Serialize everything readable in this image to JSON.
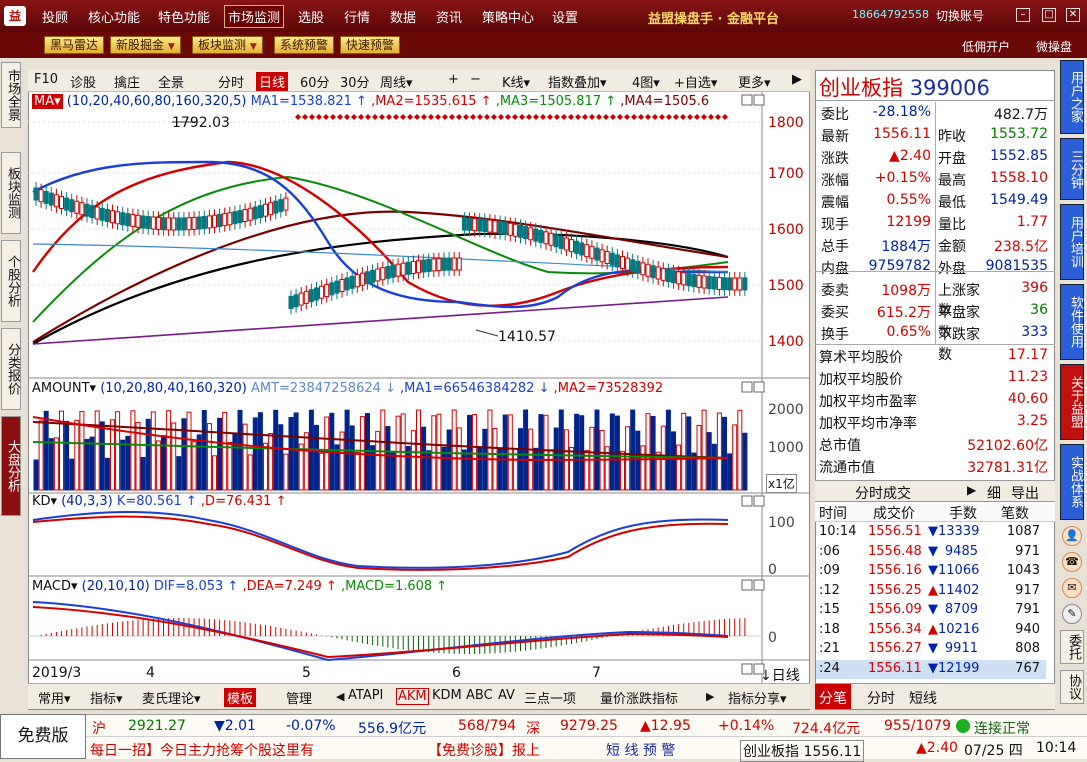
{
  "topbar": {
    "menus": [
      "投顾",
      "核心功能",
      "特色功能",
      "市场监测",
      "选股",
      "行情",
      "数据",
      "资讯",
      "策略中心",
      "设置"
    ],
    "selected": "市场监测",
    "brand": "益盟操盘手 · 金融平台",
    "phone": "18664792558",
    "account": "切换账号"
  },
  "toolbar": {
    "buttons": [
      "黑马雷达",
      "新股掘金",
      "板块监测",
      "系统预警",
      "快速预警"
    ],
    "right": [
      "低佣开户",
      "微操盘"
    ]
  },
  "lefttabs": [
    "市场全景",
    "板块监测",
    "个股分析",
    "分类报价",
    "大盘分析"
  ],
  "chart_toolbar": {
    "items": [
      "F10",
      "诊股",
      "擒庄",
      "全景",
      "分时",
      "日线",
      "60分",
      "30分",
      "周线▾",
      "+",
      "−",
      "K线▾",
      "指数叠加▾",
      "4图▾",
      "+自选▾",
      "更多▾"
    ],
    "selected": "日线"
  },
  "main_legend": {
    "name": "MA▾",
    "params": "(10,20,40,60,80,160,320,5)",
    "ma1": "MA1=1538.821 ↑",
    "ma2": ",MA2=1535.615 ↑",
    "ma3": ",MA3=1505.817 ↑",
    "ma4": ",MA4=1505.6"
  },
  "price_axis": [
    "1800",
    "1700",
    "1600",
    "1500",
    "1400"
  ],
  "annotations": {
    "high": "1792.03",
    "low": "1410.57"
  },
  "amount_legend": {
    "name": "AMOUNT▾",
    "params": "(10,20,80,40,160,320)",
    "amt": "AMT=23847258624 ↓",
    "ma1": ",MA1=66546384282 ↓",
    "ma2": ",MA2=73528392"
  },
  "amount_axis": [
    "2000",
    "1000"
  ],
  "amount_unit": "x1亿",
  "kd_legend": {
    "name": "KD▾",
    "params": "(40,3,3)",
    "k": "K=80.561 ↑",
    "d": ",D=76.431 ↑"
  },
  "kd_axis": [
    "100",
    "0"
  ],
  "macd_legend": {
    "name": "MACD▾",
    "params": "(20,10,10)",
    "dif": "DIF=8.053 ↑",
    "dea": ",DEA=7.249 ↑",
    "macd": ",MACD=1.608 ↑"
  },
  "macd_axis": [
    "0"
  ],
  "date_axis": [
    "2019/3",
    "4",
    "5",
    "6",
    "7"
  ],
  "period_label": "↓日线",
  "bottom_tabs": [
    "常用▾",
    "指标▾",
    "麦氏理论▾",
    "模板",
    "管理",
    "ATAPI",
    "AKM",
    "KDM",
    "ABC",
    "AV",
    "三点一项",
    "量价涨跌指标",
    "指标分享▾"
  ],
  "quote": {
    "name": "创业板指",
    "code": "399006",
    "rows": [
      [
        "委比",
        "-28.18%",
        "",
        "482.7万"
      ],
      [
        "最新",
        "1556.11",
        "昨收",
        "1553.72"
      ],
      [
        "涨跌",
        "▲2.40",
        "开盘",
        "1552.85"
      ],
      [
        "涨幅",
        "+0.15%",
        "最高",
        "1558.10"
      ],
      [
        "震幅",
        "0.55%",
        "最低",
        "1549.49"
      ],
      [
        "现手",
        "12199",
        "量比",
        "1.77"
      ],
      [
        "总手",
        "1884万",
        "金额",
        "238.5亿"
      ],
      [
        "内盘",
        "9759782",
        "外盘",
        "9081535"
      ],
      [
        "委卖",
        "1098万",
        "上涨家数",
        "396"
      ],
      [
        "委买",
        "615.2万",
        "平盘家数",
        "36"
      ],
      [
        "换手",
        "0.65%",
        "下跌家数",
        "333"
      ]
    ],
    "stats": [
      [
        "算术平均股价",
        "17.17"
      ],
      [
        "加权平均股价",
        "11.23"
      ],
      [
        "加权平均市盈率",
        "40.60"
      ],
      [
        "加权平均市净率",
        "3.25"
      ],
      [
        "总市值",
        "52102.60亿"
      ],
      [
        "流通市值",
        "32781.31亿"
      ]
    ]
  },
  "ticks": {
    "title": "分时成交",
    "links": [
      "细",
      "导出"
    ],
    "headers": [
      "时间",
      "成交价",
      "手数",
      "笔数"
    ],
    "rows": [
      [
        "10:14",
        "1556.51",
        "▼",
        "13339",
        "1087"
      ],
      [
        ":06",
        "1556.48",
        "▼",
        "9485",
        "971"
      ],
      [
        ":09",
        "1556.16",
        "▼",
        "11066",
        "1043"
      ],
      [
        ":12",
        "1556.25",
        "▲",
        "11402",
        "917"
      ],
      [
        ":15",
        "1556.09",
        "▼",
        "8709",
        "791"
      ],
      [
        ":18",
        "1556.34",
        "▲",
        "10216",
        "940"
      ],
      [
        ":21",
        "1556.27",
        "▼",
        "9911",
        "808"
      ],
      [
        ":24",
        "1556.11",
        "▼",
        "12199",
        "767"
      ]
    ]
  },
  "ticks_tabs": [
    "分笔",
    "分时",
    "短线"
  ],
  "righttabs": [
    "用户之家",
    "三分钟",
    "用户培训",
    "软件使用",
    "关于益盟",
    "实战体系",
    "委托",
    "协议"
  ],
  "status1": {
    "sh": "沪",
    "sh_val": "2921.27",
    "sh_chg": "▼2.01",
    "sh_pct": "-0.07%",
    "sh_amt": "556.9亿元",
    "sh_ud": "568/794",
    "sz": "深",
    "sz_val": "9279.25",
    "sz_chg": "▲12.95",
    "sz_pct": "+0.14%",
    "sz_amt": "724.4亿元",
    "sz_ud": "955/1079",
    "conn": "连接正常"
  },
  "status2": {
    "ticker": "每日一招】今日主力抢筹个股这里有",
    "ticker2": "【免费诊股】报上",
    "alert": "短 线 预 警",
    "idx": "创业板指 1556.11",
    "chg": "▲2.40",
    "date": "07/25 四",
    "time": "10:14"
  },
  "free_label": "免费版"
}
